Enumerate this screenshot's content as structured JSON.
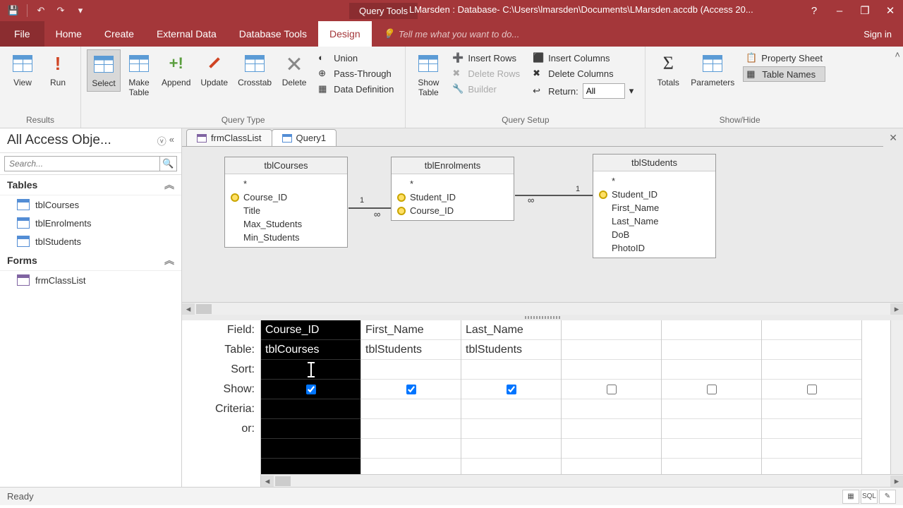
{
  "titlebar": {
    "tools": "Query Tools",
    "path": "LMarsden : Database- C:\\Users\\lmarsden\\Documents\\LMarsden.accdb (Access 20...",
    "help": "?",
    "min": "–",
    "max": "❐",
    "close": "✕"
  },
  "menu": {
    "file": "File",
    "home": "Home",
    "create": "Create",
    "external": "External Data",
    "dbtools": "Database Tools",
    "design": "Design",
    "tellme": "Tell me what you want to do...",
    "signin": "Sign in"
  },
  "ribbon": {
    "results": {
      "view": "View",
      "run": "Run",
      "label": "Results"
    },
    "qtype": {
      "select": "Select",
      "make": "Make\nTable",
      "append": "Append",
      "update": "Update",
      "crosstab": "Crosstab",
      "delete": "Delete",
      "union": "Union",
      "pass": "Pass-Through",
      "datadef": "Data Definition",
      "label": "Query Type"
    },
    "setup": {
      "showtable": "Show\nTable",
      "insrows": "Insert Rows",
      "delrows": "Delete Rows",
      "builder": "Builder",
      "inscols": "Insert Columns",
      "delcols": "Delete Columns",
      "return": "Return:",
      "returnval": "All",
      "label": "Query Setup"
    },
    "showhide": {
      "totals": "Totals",
      "params": "Parameters",
      "propsheet": "Property Sheet",
      "tablenames": "Table Names",
      "label": "Show/Hide"
    }
  },
  "nav": {
    "title": "All Access Obje...",
    "search": "Search...",
    "groups": [
      {
        "name": "Tables",
        "items": [
          "tblCourses",
          "tblEnrolments",
          "tblStudents"
        ]
      },
      {
        "name": "Forms",
        "items": [
          "frmClassList"
        ]
      }
    ]
  },
  "doctabs": [
    {
      "label": "frmClassList"
    },
    {
      "label": "Query1"
    }
  ],
  "diagram": {
    "t1": {
      "name": "tblCourses",
      "fields": [
        "*",
        "Course_ID",
        "Title",
        "Max_Students",
        "Min_Students"
      ],
      "keys": [
        1
      ]
    },
    "t2": {
      "name": "tblEnrolments",
      "fields": [
        "*",
        "Student_ID",
        "Course_ID"
      ],
      "keys": [
        1,
        2
      ]
    },
    "t3": {
      "name": "tblStudents",
      "fields": [
        "*",
        "Student_ID",
        "First_Name",
        "Last_Name",
        "DoB",
        "PhotoID"
      ],
      "keys": [
        1
      ]
    }
  },
  "grid": {
    "rows": [
      "Field:",
      "Table:",
      "Sort:",
      "Show:",
      "Criteria:",
      "or:"
    ],
    "cols": [
      {
        "field": "Course_ID",
        "table": "tblCourses",
        "show": true,
        "selected": true
      },
      {
        "field": "First_Name",
        "table": "tblStudents",
        "show": true
      },
      {
        "field": "Last_Name",
        "table": "tblStudents",
        "show": true
      },
      {
        "field": "",
        "table": "",
        "show": false
      },
      {
        "field": "",
        "table": "",
        "show": false
      },
      {
        "field": "",
        "table": "",
        "show": false
      }
    ]
  },
  "status": {
    "ready": "Ready",
    "sql": "SQL"
  }
}
